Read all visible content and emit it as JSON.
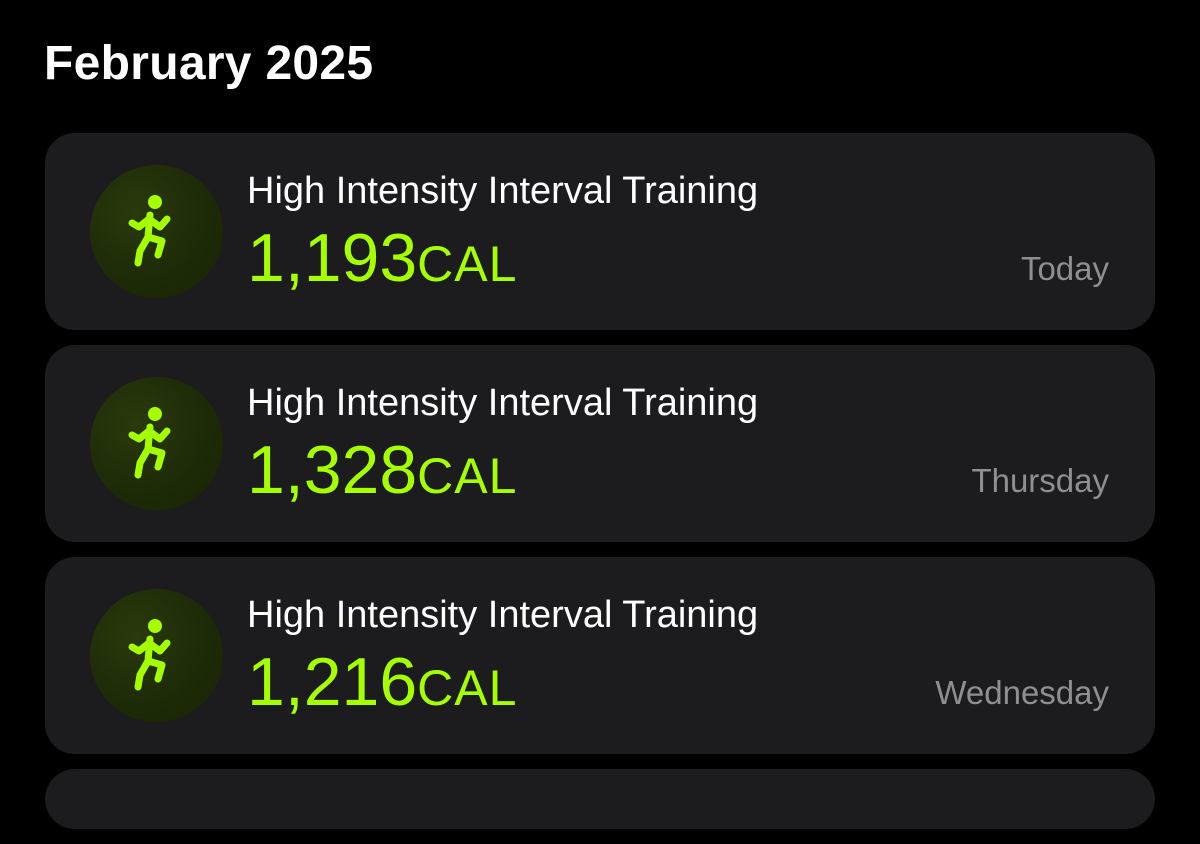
{
  "header": {
    "title": "February 2025"
  },
  "colors": {
    "background": "#000000",
    "card": "#1c1c1e",
    "accent": "#a6ff00",
    "secondary_text": "#8e8e93"
  },
  "workouts": [
    {
      "icon": "running-figure-icon",
      "name": "High Intensity Interval Training",
      "calories": "1,193",
      "unit": "CAL",
      "date": "Today"
    },
    {
      "icon": "running-figure-icon",
      "name": "High Intensity Interval Training",
      "calories": "1,328",
      "unit": "CAL",
      "date": "Thursday"
    },
    {
      "icon": "running-figure-icon",
      "name": "High Intensity Interval Training",
      "calories": "1,216",
      "unit": "CAL",
      "date": "Wednesday"
    }
  ]
}
